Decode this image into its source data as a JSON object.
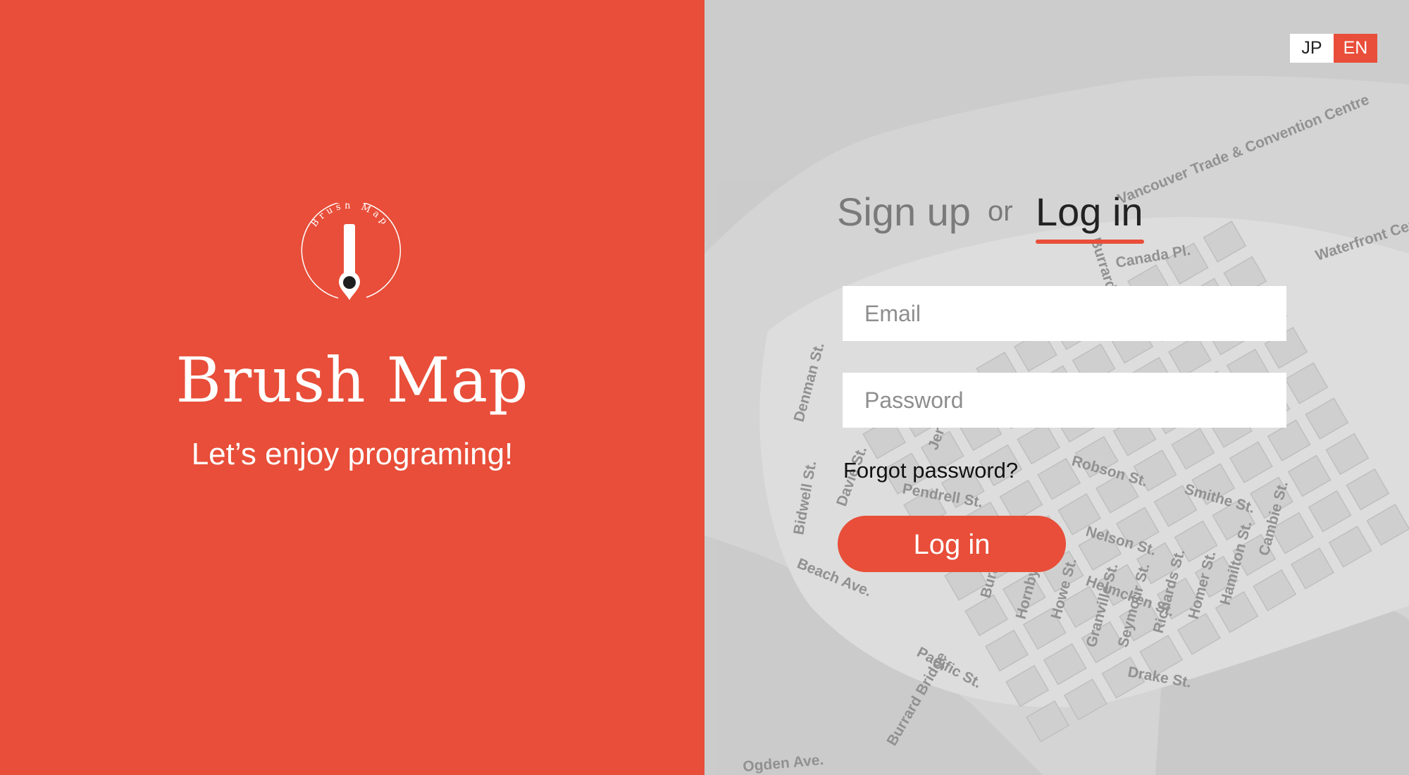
{
  "brand": {
    "logo_text": "Brush Map",
    "title": "Brush Map",
    "tagline": "Let’s enjoy programing!"
  },
  "language": {
    "options": [
      "JP",
      "EN"
    ],
    "selected": "EN"
  },
  "auth": {
    "signup_tab": "Sign up",
    "separator": "or",
    "login_tab": "Log in",
    "email_placeholder": "Email",
    "password_placeholder": "Password",
    "forgot_link": "Forgot password?",
    "submit_label": "Log in"
  },
  "map_labels": [
    "Vancouver Trade & Convention Centre",
    "Canada Pl.",
    "Waterfront Centre",
    "Burrard Pl.",
    "Robson St.",
    "Smithe St.",
    "Nelson St.",
    "Burrard St.",
    "Hornby St.",
    "Howe St.",
    "Granville St.",
    "Seymour St.",
    "Richards St.",
    "Homer St.",
    "Hamilton St.",
    "Cambie St.",
    "Pacific St.",
    "Beach Ave.",
    "Burrard Bridge",
    "Ogden Ave.",
    "Jervis St.",
    "Pendrell St.",
    "Bidwell St.",
    "Denman St.",
    "Helmcken St.",
    "Drake St.",
    "Davie St."
  ],
  "colors": {
    "accent": "#E84E39",
    "map_background": "#d4d4d4"
  }
}
